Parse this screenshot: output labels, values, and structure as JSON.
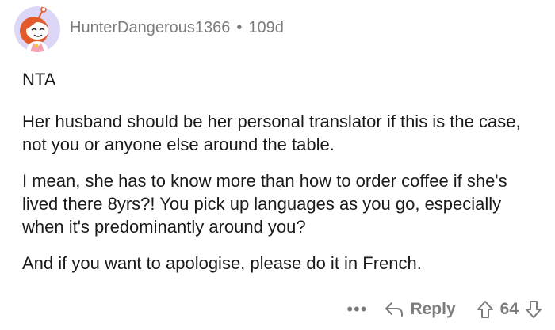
{
  "comment": {
    "author": "HunterDangerous1366",
    "separator": "•",
    "age": "109d",
    "paragraphs": [
      "NTA",
      "Her husband should be her personal translator if this is the case, not you or anyone else around the table.",
      "I mean, she has to know more than how to order coffee if she's lived there 8yrs?! You pick up languages as you go, especially when it's predominantly around you?",
      "And if you want to apologise, please do it in French."
    ]
  },
  "actions": {
    "more_label": "•••",
    "reply_label": "Reply",
    "score": "64"
  },
  "icons": {
    "avatar": "snoo-avatar-icon",
    "reply": "reply-arrow-icon",
    "upvote": "upvote-arrow-icon",
    "downvote": "downvote-arrow-icon"
  },
  "colors": {
    "text": "#1a1a1b",
    "meta": "#7c7c7c",
    "avatar_bg": "#dcd6f7",
    "avatar_hair": "#e35a2a"
  }
}
